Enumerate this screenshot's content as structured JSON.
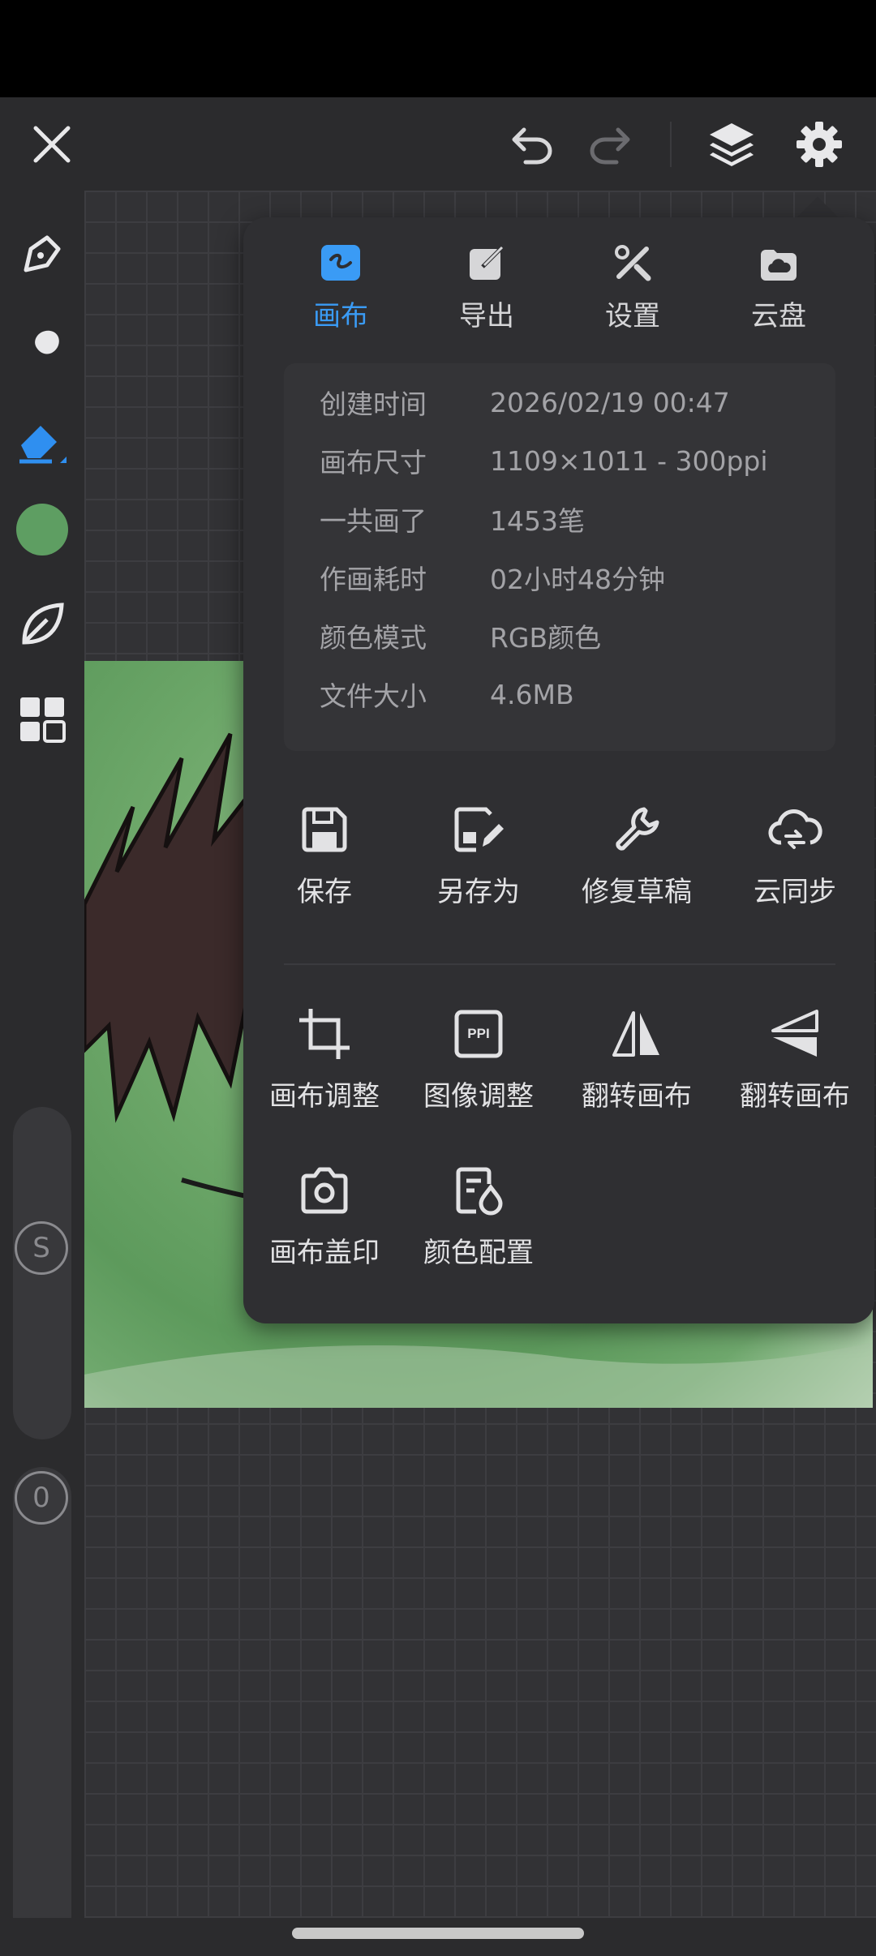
{
  "toolbar": {
    "close_icon": "close-icon",
    "undo_icon": "undo-icon",
    "redo_icon": "redo-icon",
    "layers_icon": "layers-icon",
    "settings_icon": "gear-icon"
  },
  "left_tools": {
    "color_swatch": "#5e9e62",
    "brush_size_label": "S",
    "opacity_label": "0"
  },
  "panel": {
    "tabs": [
      {
        "label": "画布",
        "icon": "canvas-icon",
        "active": true
      },
      {
        "label": "导出",
        "icon": "export-icon",
        "active": false
      },
      {
        "label": "设置",
        "icon": "tools-icon",
        "active": false
      },
      {
        "label": "云盘",
        "icon": "cloud-drive-icon",
        "active": false
      }
    ],
    "info": [
      {
        "key": "创建时间",
        "value": "2026/02/19 00:47"
      },
      {
        "key": "画布尺寸",
        "value": "1109×1011 - 300ppi"
      },
      {
        "key": "一共画了",
        "value": "1453笔"
      },
      {
        "key": "作画耗时",
        "value": "02小时48分钟"
      },
      {
        "key": "颜色模式",
        "value": "RGB颜色"
      },
      {
        "key": "文件大小",
        "value": "4.6MB"
      }
    ],
    "actions_row1": [
      {
        "label": "保存",
        "icon": "save-icon"
      },
      {
        "label": "另存为",
        "icon": "save-as-icon"
      },
      {
        "label": "修复草稿",
        "icon": "wrench-icon"
      },
      {
        "label": "云同步",
        "icon": "cloud-sync-icon"
      }
    ],
    "actions_row2": [
      {
        "label": "画布调整",
        "icon": "crop-icon"
      },
      {
        "label": "图像调整",
        "icon": "ppi-icon",
        "icon_text": "PPI"
      },
      {
        "label": "翻转画布",
        "icon": "flip-horizontal-icon"
      },
      {
        "label": "翻转画布",
        "icon": "flip-vertical-icon"
      }
    ],
    "actions_row3": [
      {
        "label": "画布盖印",
        "icon": "camera-icon"
      },
      {
        "label": "颜色配置",
        "icon": "color-profile-icon"
      }
    ]
  },
  "colors": {
    "accent": "#3a9bf5",
    "panel_bg": "#2f2f32",
    "canvas_green": "#6ea86a"
  }
}
